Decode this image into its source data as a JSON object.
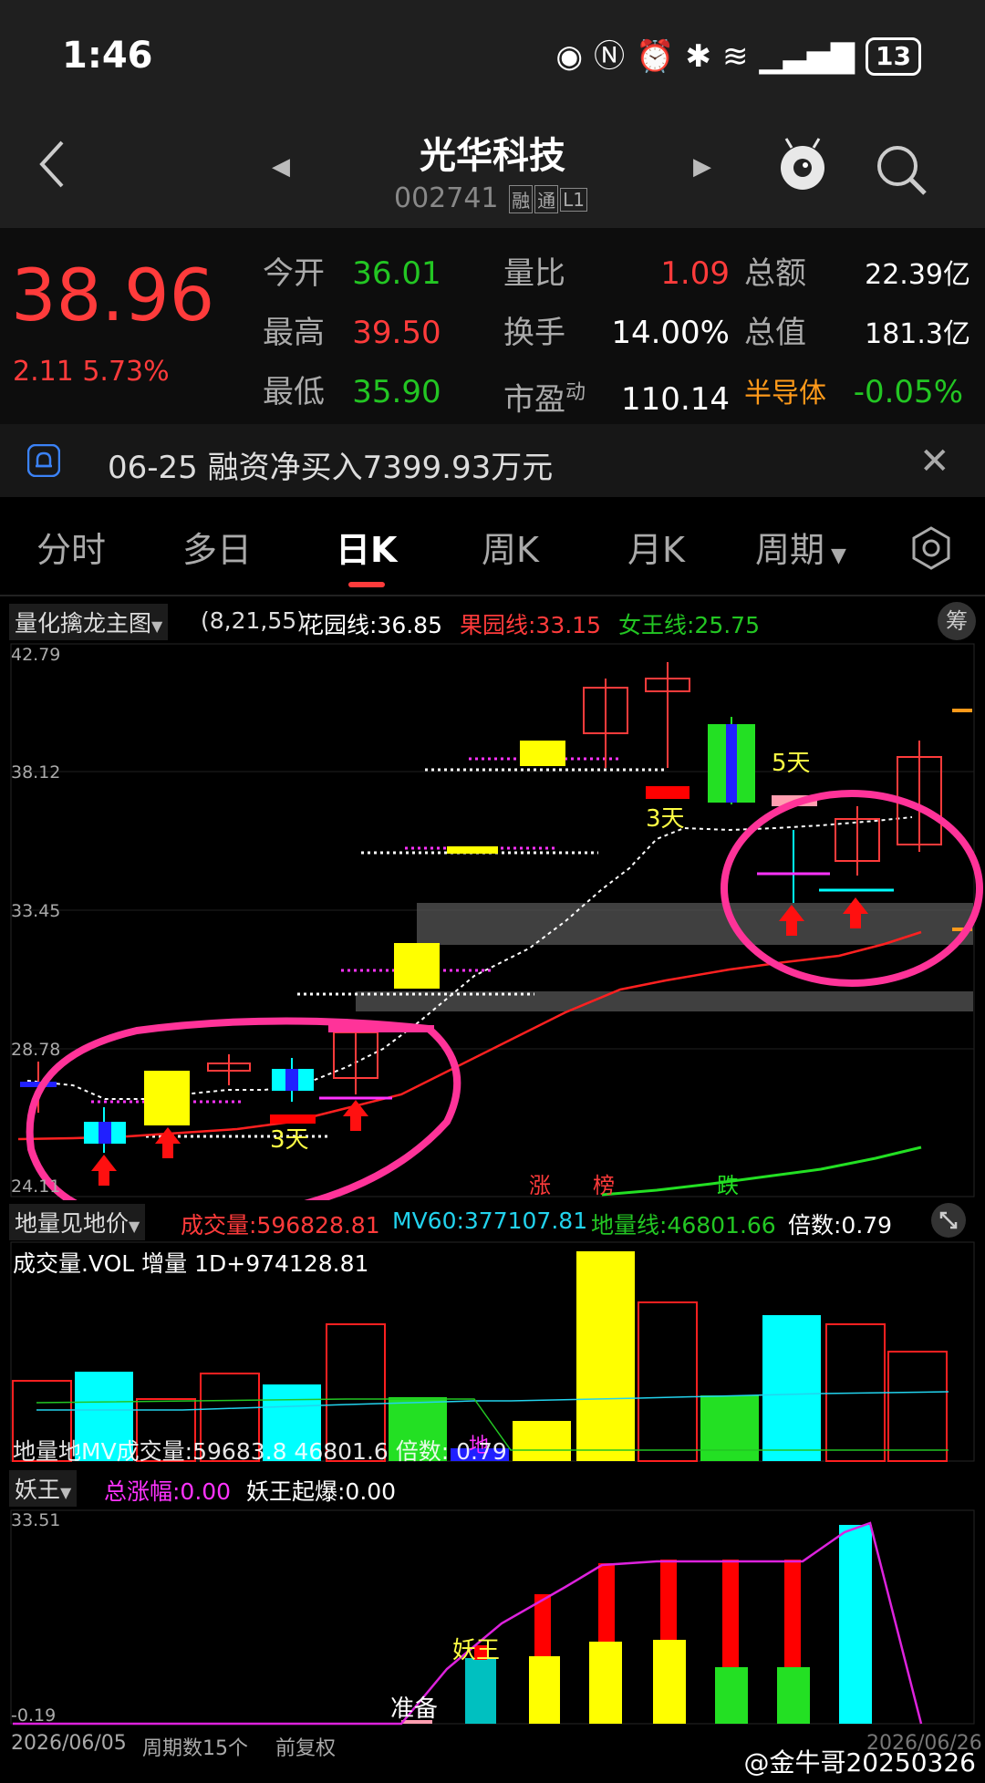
{
  "status": {
    "time": "1:46",
    "battery": "13"
  },
  "header": {
    "name": "光华科技",
    "code": "002741",
    "tags": [
      "融",
      "通",
      "L1"
    ]
  },
  "quote": {
    "price": "38.96",
    "change": "2.11",
    "change_pct": "5.73%",
    "col1": [
      {
        "label": "今开",
        "value": "36.01",
        "color": "#23c623"
      },
      {
        "label": "最高",
        "value": "39.50",
        "color": "#ff3b3b"
      },
      {
        "label": "最低",
        "value": "35.90",
        "color": "#23c623"
      }
    ],
    "col2": [
      {
        "label": "量比",
        "value": "1.09",
        "color": "#ff3b3b"
      },
      {
        "label": "换手",
        "value": "14.00%",
        "color": "#ffffff"
      },
      {
        "label": "市盈",
        "sup": "动",
        "value": "110.14",
        "color": "#ffffff"
      }
    ],
    "col3": [
      {
        "label": "总额",
        "value": "22.39亿",
        "color": "#ffffff"
      },
      {
        "label": "总值",
        "value": "181.3亿",
        "color": "#ffffff"
      },
      {
        "label": "半导体",
        "value": "-0.05%",
        "color": "#23c623",
        "label_color": "#ff9a1a"
      }
    ]
  },
  "notice": {
    "text": "06-25 融资净买入7399.93万元"
  },
  "tabs": [
    "分时",
    "多日",
    "日K",
    "周K",
    "月K",
    "周期"
  ],
  "main_indicator": {
    "name": "量化擒龙主图",
    "params": "(8,21,55)",
    "line1": "花园线:36.85",
    "line2": "果园线:33.15",
    "line3": "女王线:25.75",
    "btn": "筹"
  },
  "price_axis": [
    "42.79",
    "38.12",
    "33.45",
    "28.78",
    "24.11"
  ],
  "chart_labels": {
    "days5": "5天",
    "days3a": "3天",
    "days3b": "3天",
    "zhang": "涨",
    "bang": "榜",
    "die": "跌"
  },
  "volume_indicator": {
    "name": "地量见地价",
    "vol": "成交量:596828.81",
    "mv60": "MV60:377107.81",
    "diliang": "地量线:46801.66",
    "beishu": "倍数:0.79",
    "overlay1": "成交量.VOL 增量 1D+974128.81",
    "overlay2": "地量地MV成交量:59683.8 46801.6 倍数: 0.79",
    "di": "地"
  },
  "yao_indicator": {
    "name": "妖王",
    "total": "总涨幅:0.00",
    "qibao": "妖王起爆:0.00",
    "axis_top": "33.51",
    "axis_bottom": "-0.19",
    "label_yao": "妖王",
    "label_zhunbei": "准备"
  },
  "footer": {
    "start_date": "2026/06/05",
    "periods": "周期数15个",
    "adjust": "前复权",
    "end_date": "2026/06/26",
    "watermark": "@金牛哥20250326"
  },
  "colors": {
    "up": "#ff3b3b",
    "down": "#23c623",
    "yellow": "#ffff00",
    "cyan": "#00ffff",
    "magenta": "#ff3399"
  }
}
